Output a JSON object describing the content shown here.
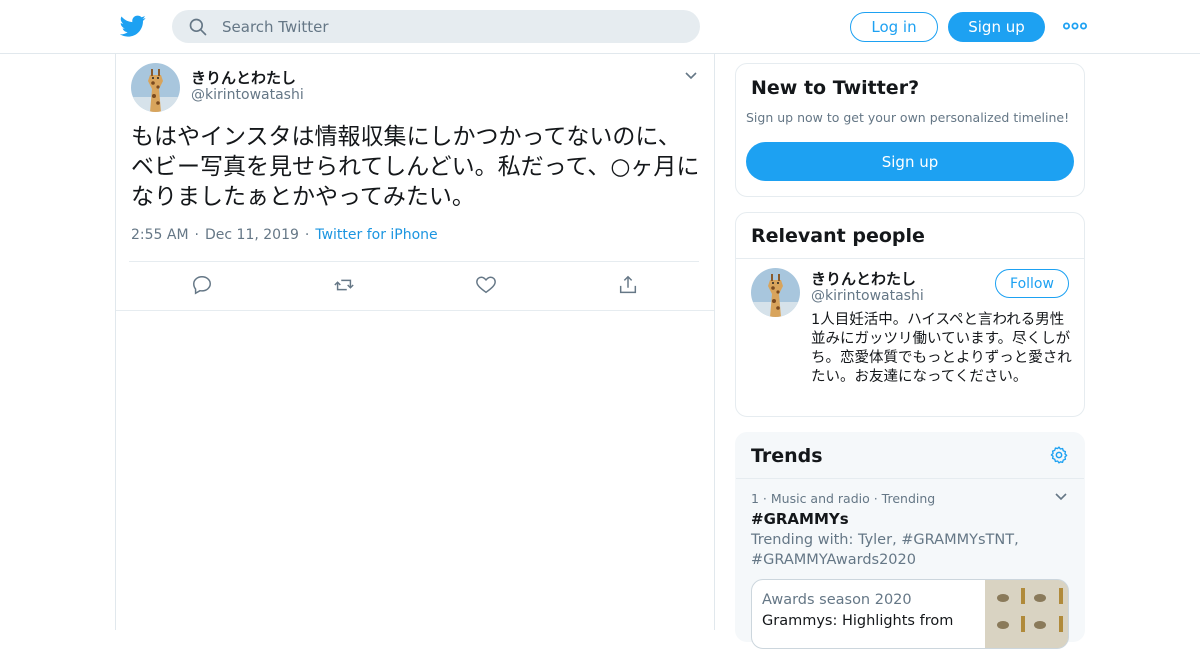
{
  "header": {
    "logo": "twitter-bird-icon",
    "search_placeholder": "Search Twitter",
    "login_label": "Log in",
    "signup_label": "Sign up",
    "more_icon": "more-dots-icon"
  },
  "tweet": {
    "display_name": "きりんとわたし",
    "handle": "@kirintowatashi",
    "text": "もはやインスタは情報収集にしかつかってないのに、ベビー写真を見せられてしんどい。私だって、○ヶ月になりましたぁとかやってみたい。",
    "time": "2:55 AM",
    "date": "Dec 11, 2019",
    "source": "Twitter for iPhone",
    "separator": "·"
  },
  "new_to_twitter": {
    "title": "New to Twitter?",
    "subtitle": "Sign up now to get your own personalized timeline!",
    "signup_label": "Sign up"
  },
  "relevant_people": {
    "title": "Relevant people",
    "display_name": "きりんとわたし",
    "handle": "@kirintowatashi",
    "follow_label": "Follow",
    "bio": "1人目妊活中。ハイスペと言われる男性並みにガッツリ働いています。尽くしがち。恋愛体質でもっとよりずっと愛されたい。お友達になってください。"
  },
  "trends": {
    "title": "Trends",
    "item": {
      "meta": "1 · Music and radio · Trending",
      "tag": "#GRAMMYs",
      "trending_with": "Trending with: Tyler, #GRAMMYsTNT, #GRAMMYAwards2020",
      "story_category": "Awards season 2020",
      "story_headline": "Grammys: Highlights from"
    }
  },
  "colors": {
    "accent": "#1da1f2",
    "link": "#1b95e0",
    "muted": "#657786",
    "text": "#14171a",
    "border": "#e6ecf0",
    "search_bg": "#e6ecf0",
    "trends_bg": "#f5f8fa"
  }
}
